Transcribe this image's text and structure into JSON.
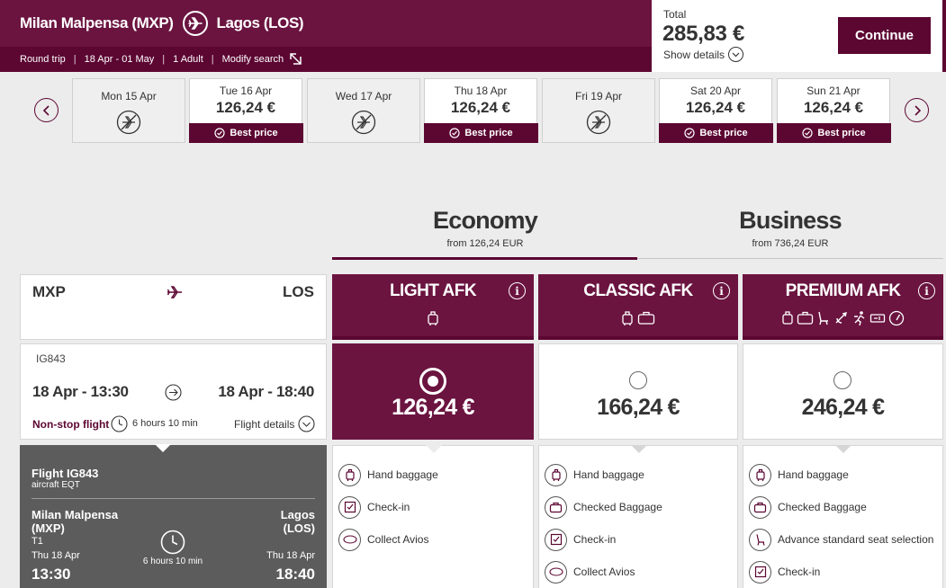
{
  "header": {
    "origin": "Milan Malpensa (MXP)",
    "destination": "Lagos (LOS)",
    "trip_type": "Round trip",
    "dates": "18 Apr - 01 May",
    "passengers": "1 Adult",
    "modify": "Modify search",
    "total_label": "Total",
    "total_value": "285,83 €",
    "show_details": "Show details",
    "continue": "Continue"
  },
  "date_strip": [
    {
      "label": "Mon 15 Apr",
      "price": "",
      "best": ""
    },
    {
      "label": "Tue 16 Apr",
      "price": "126,24 €",
      "best": "Best price"
    },
    {
      "label": "Wed 17 Apr",
      "price": "",
      "best": ""
    },
    {
      "label": "Thu 18 Apr",
      "price": "126,24 €",
      "best": "Best price"
    },
    {
      "label": "Fri 19 Apr",
      "price": "",
      "best": ""
    },
    {
      "label": "Sat 20 Apr",
      "price": "126,24 €",
      "best": "Best price"
    },
    {
      "label": "Sun 21 Apr",
      "price": "126,24 €",
      "best": "Best price"
    }
  ],
  "cabins": [
    {
      "name": "Economy",
      "from": "from 126,24 EUR"
    },
    {
      "name": "Business",
      "from": "from 736,24 EUR"
    }
  ],
  "route": {
    "from": "MXP",
    "to": "LOS"
  },
  "flight": {
    "number": "IG843",
    "depart": "18 Apr - 13:30",
    "arrive": "18 Apr - 18:40",
    "nonstop": "Non-stop flight",
    "duration": "6 hours 10 min",
    "details": "Flight details"
  },
  "flight_detail": {
    "title": "Flight IG843",
    "aircraft": "aircraft EQT",
    "dep_city": "Milan Malpensa",
    "dep_code": "(MXP)",
    "terminal": "T1",
    "dep_date": "Thu 18 Apr",
    "dep_time": "13:30",
    "duration": "6 hours 10 min",
    "arr_city": "Lagos",
    "arr_code": "(LOS)",
    "arr_date": "Thu 18 Apr",
    "arr_time": "18:40"
  },
  "fares": [
    {
      "name": "LIGHT AFK",
      "price": "126,24 €",
      "features": [
        "Hand baggage",
        "Check-in",
        "Collect Avios"
      ]
    },
    {
      "name": "CLASSIC AFK",
      "price": "166,24 €",
      "features": [
        "Hand baggage",
        "Checked Baggage",
        "Check-in",
        "Collect Avios"
      ]
    },
    {
      "name": "PREMIUM AFK",
      "price": "246,24 €",
      "features": [
        "Hand baggage",
        "Checked Baggage",
        "Advance standard seat selection",
        "Check-in"
      ]
    }
  ],
  "colors": {
    "brand": "#5c0632",
    "brand_light": "#6b1440",
    "dark_panel": "#5c5c5c"
  }
}
